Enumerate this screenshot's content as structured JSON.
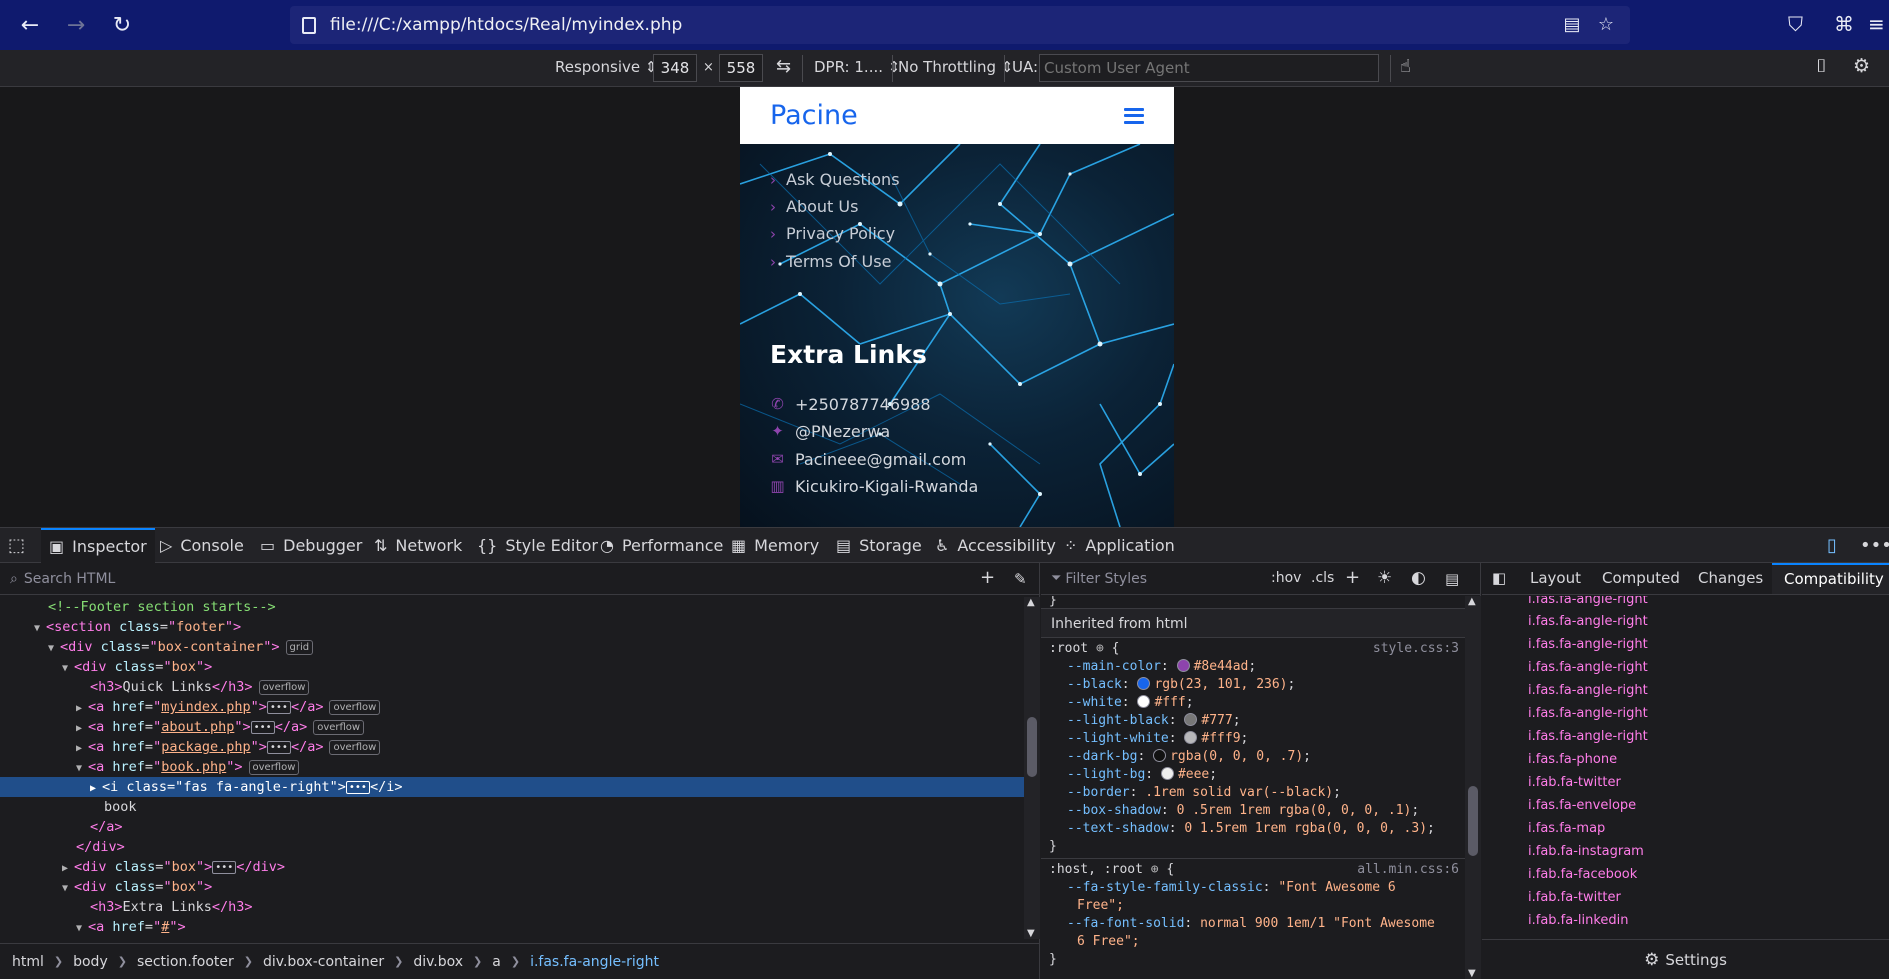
{
  "browser": {
    "url": "file:///C:/xampp/htdocs/Real/myindex.php"
  },
  "rdm": {
    "device": "Responsive",
    "width": "348",
    "times": "×",
    "height": "558",
    "dpr": "DPR: 1....",
    "throttling": "No Throttling",
    "ua_label": "UA:",
    "ua_placeholder": "Custom User Agent"
  },
  "site": {
    "logo": "Pacine",
    "quick_links": [
      "Ask Questions",
      "About Us",
      "Privacy Policy",
      "Terms Of Use"
    ],
    "extra_title": "Extra Links",
    "contacts": [
      "+250787746988",
      "@PNezerwa",
      "Pacineee@gmail.com",
      "Kicukiro-Kigali-Rwanda"
    ],
    "accent_color": "#8e44ad",
    "logo_color": "#1765ec"
  },
  "devtools": {
    "tabs": [
      "Inspector",
      "Console",
      "Debugger",
      "Network",
      "Style Editor",
      "Performance",
      "Memory",
      "Storage",
      "Accessibility",
      "Application"
    ],
    "search_placeholder": "Search HTML",
    "filter_placeholder": "Filter Styles",
    "hov": ":hov",
    "cls": ".cls",
    "markup": {
      "comment": "<!--Footer section starts-->",
      "section_class": "footer",
      "box_container_class": "box-container",
      "box_class": "box",
      "h3_quick": "Quick Links",
      "h3_extra": "Extra Links",
      "hrefs": [
        "myindex.php",
        "about.php",
        "package.php",
        "book.php"
      ],
      "i_class": "fas fa-angle-right",
      "book_text": "book",
      "hash_href": "#",
      "badge_grid": "grid",
      "badge_overflow": "overflow"
    },
    "breadcrumb": [
      "html",
      "body",
      "section.footer",
      "div.box-container",
      "div.box",
      "a",
      "i.fas.fa-angle-right"
    ],
    "rules": {
      "inherited": "Inherited from html",
      "root_selector": ":root",
      "root_source": "style.css:3",
      "root_decls": [
        {
          "p": "--main-color",
          "v": "#8e44ad",
          "swatch": "#8e44ad"
        },
        {
          "p": "--black",
          "v": "rgb(23, 101, 236)",
          "swatch": "#1765ec"
        },
        {
          "p": "--white",
          "v": "#fff",
          "swatch": "#ffffff"
        },
        {
          "p": "--light-black",
          "v": "#777",
          "swatch": "#777777"
        },
        {
          "p": "--light-white",
          "v": "#fff9",
          "swatch": "#ffffff99"
        },
        {
          "p": "--dark-bg",
          "v": "rgba(0, 0, 0, .7)",
          "swatch": "#000000b3"
        },
        {
          "p": "--light-bg",
          "v": "#eee",
          "swatch": "#eeeeee"
        },
        {
          "p": "--border",
          "v": ".1rem solid var(--black)",
          "swatch": ""
        },
        {
          "p": "--box-shadow",
          "v": "0 .5rem 1rem rgba(0, 0, 0, .1)",
          "swatch": ""
        },
        {
          "p": "--text-shadow",
          "v": "0 1.5rem 1rem rgba(0, 0, 0, .3)",
          "swatch": ""
        }
      ],
      "host_selector": ":host, :root",
      "host_source": "all.min.css:6",
      "host_decl1_p": "--fa-style-family-classic",
      "host_decl1_v": "\"Font Awesome 6",
      "host_decl1_v2": "Free\";",
      "host_decl2_p": "--fa-font-solid",
      "host_decl2_v": "normal 900 1em/1 \"Font Awesome",
      "host_decl2_v2": "6 Free\";"
    },
    "compat_tabs": [
      "Layout",
      "Computed",
      "Changes",
      "Compatibility"
    ],
    "compat_items": [
      "i.fas.fa-angle-right",
      "i.fas.fa-angle-right",
      "i.fas.fa-angle-right",
      "i.fas.fa-angle-right",
      "i.fas.fa-angle-right",
      "i.fas.fa-angle-right",
      "i.fas.fa-angle-right",
      "i.fas.fa-angle-right",
      "i.fas.fa-phone",
      "i.fab.fa-twitter",
      "i.fas.fa-envelope",
      "i.fas.fa-map",
      "i.fab.fa-instagram",
      "i.fab.fa-facebook",
      "i.fab.fa-twitter",
      "i.fab.fa-linkedin"
    ],
    "settings": "Settings"
  }
}
